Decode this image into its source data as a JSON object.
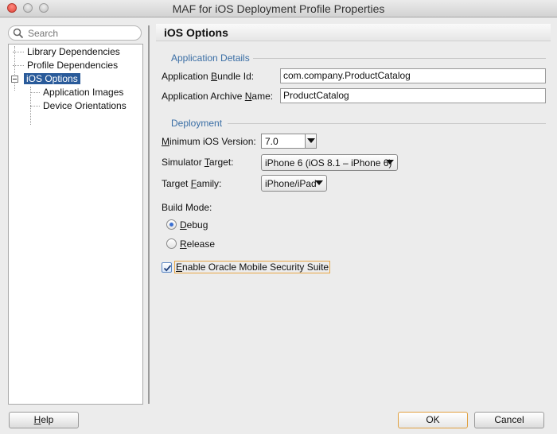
{
  "window": {
    "title": "MAF for iOS Deployment Profile Properties"
  },
  "search": {
    "placeholder": "Search"
  },
  "tree": {
    "items": [
      {
        "label": "Library Dependencies"
      },
      {
        "label": "Profile Dependencies"
      },
      {
        "label": "iOS Options",
        "selected": true
      },
      {
        "label": "Application Images"
      },
      {
        "label": "Device Orientations"
      }
    ]
  },
  "main": {
    "title": "iOS Options",
    "app_details": {
      "group_label": "Application Details",
      "bundle_id_label_pre": "Application ",
      "bundle_id_label_mn": "B",
      "bundle_id_label_post": "undle Id:",
      "bundle_id_value": "com.company.ProductCatalog",
      "archive_label_pre": "Application Archive ",
      "archive_label_mn": "N",
      "archive_label_post": "ame:",
      "archive_value": "ProductCatalog"
    },
    "deployment": {
      "group_label": "Deployment",
      "min_ios_label_pre": "",
      "min_ios_label_mn": "M",
      "min_ios_label_post": "inimum iOS Version:",
      "min_ios_value": "7.0",
      "sim_label_pre": "Simulator ",
      "sim_label_mn": "T",
      "sim_label_post": "arget:",
      "sim_value": "iPhone 6 (iOS 8.1 – iPhone 6)",
      "family_label_pre": "Target ",
      "family_label_mn": "F",
      "family_label_post": "amily:",
      "family_value": "iPhone/iPad",
      "build_mode_label": "Build Mode:",
      "debug_mn": "D",
      "debug_post": "ebug",
      "release_mn": "R",
      "release_post": "elease",
      "build_mode_selected": "Debug"
    },
    "security": {
      "label_mn": "E",
      "label_post": "nable Oracle Mobile Security Suite",
      "checked": true
    }
  },
  "buttons": {
    "help_mn": "H",
    "help_post": "elp",
    "ok": "OK",
    "cancel": "Cancel"
  },
  "colors": {
    "selection": "#2a5b9a",
    "group_label": "#3a6ea5",
    "focus_ring": "#e8a645"
  }
}
